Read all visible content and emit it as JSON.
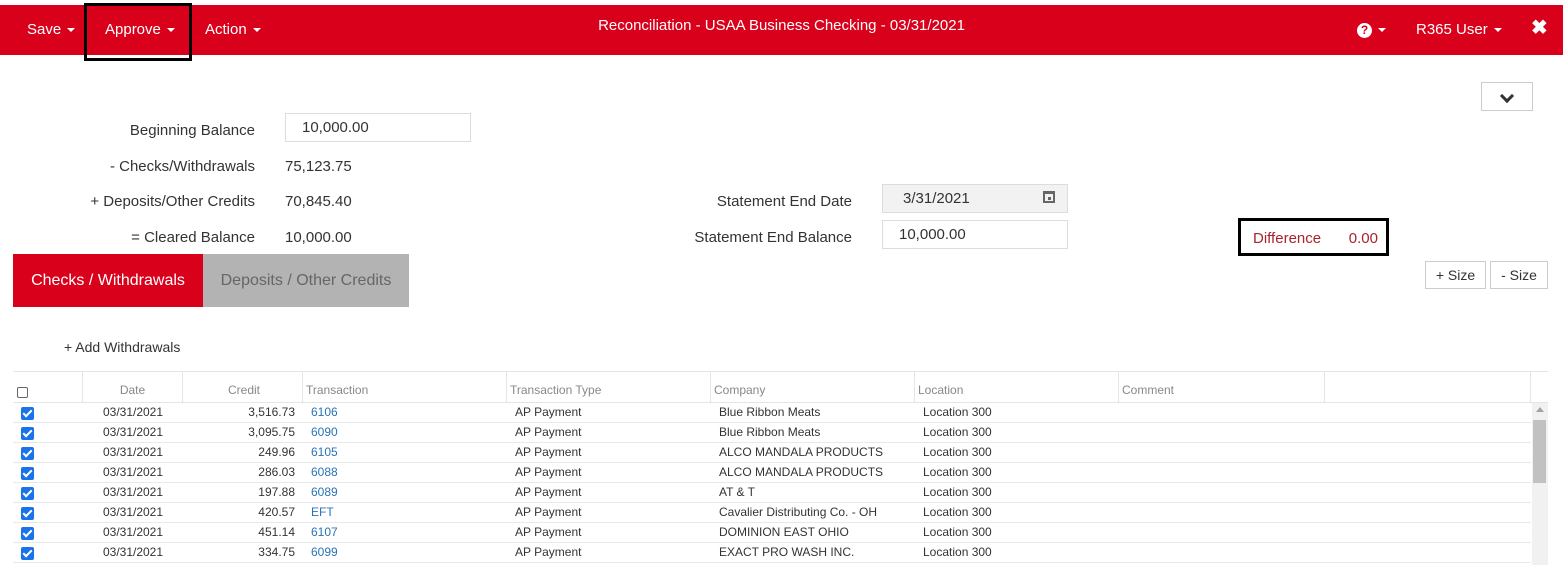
{
  "header": {
    "menus": [
      "Save",
      "Approve",
      "Action"
    ],
    "title": "Reconciliation - USAA Business Checking - 03/31/2021",
    "help_symbol": "?",
    "user_menu": "R365 User",
    "close_symbol": "✖"
  },
  "summary": {
    "beginning_balance_label": "Beginning Balance",
    "beginning_balance_value": "10,000.00",
    "checks_label": "- Checks/Withdrawals",
    "checks_value": "75,123.75",
    "deposits_label": "+ Deposits/Other Credits",
    "deposits_value": "70,845.40",
    "cleared_label": "= Cleared Balance",
    "cleared_value": "10,000.00",
    "statement_end_date_label": "Statement End Date",
    "statement_end_date_value": "3/31/2021",
    "statement_end_balance_label": "Statement End Balance",
    "statement_end_balance_value": "10,000.00",
    "difference_label": "Difference",
    "difference_value": "0.00"
  },
  "tabs": {
    "active": "Checks / Withdrawals",
    "inactive": "Deposits / Other Credits"
  },
  "size_buttons": {
    "increase": "+ Size",
    "decrease": "- Size"
  },
  "add_withdrawals": "+ Add Withdrawals",
  "grid": {
    "columns": [
      "Date",
      "Credit",
      "Transaction",
      "Transaction Type",
      "Company",
      "Location",
      "Comment"
    ],
    "rows": [
      {
        "checked": true,
        "date": "03/31/2021",
        "credit": "3,516.73",
        "transaction": "6106",
        "type": "AP Payment",
        "company": "Blue Ribbon Meats",
        "location": "Location 300",
        "comment": ""
      },
      {
        "checked": true,
        "date": "03/31/2021",
        "credit": "3,095.75",
        "transaction": "6090",
        "type": "AP Payment",
        "company": "Blue Ribbon Meats",
        "location": "Location 300",
        "comment": ""
      },
      {
        "checked": true,
        "date": "03/31/2021",
        "credit": "249.96",
        "transaction": "6105",
        "type": "AP Payment",
        "company": "ALCO MANDALA PRODUCTS",
        "location": "Location 300",
        "comment": ""
      },
      {
        "checked": true,
        "date": "03/31/2021",
        "credit": "286.03",
        "transaction": "6088",
        "type": "AP Payment",
        "company": "ALCO MANDALA PRODUCTS",
        "location": "Location 300",
        "comment": ""
      },
      {
        "checked": true,
        "date": "03/31/2021",
        "credit": "197.88",
        "transaction": "6089",
        "type": "AP Payment",
        "company": "AT & T",
        "location": "Location 300",
        "comment": ""
      },
      {
        "checked": true,
        "date": "03/31/2021",
        "credit": "420.57",
        "transaction": "EFT",
        "type": "AP Payment",
        "company": "Cavalier Distributing Co. - OH",
        "location": "Location 300",
        "comment": ""
      },
      {
        "checked": true,
        "date": "03/31/2021",
        "credit": "451.14",
        "transaction": "6107",
        "type": "AP Payment",
        "company": "DOMINION EAST OHIO",
        "location": "Location 300",
        "comment": ""
      },
      {
        "checked": true,
        "date": "03/31/2021",
        "credit": "334.75",
        "transaction": "6099",
        "type": "AP Payment",
        "company": "EXACT PRO WASH INC.",
        "location": "Location 300",
        "comment": ""
      }
    ]
  },
  "colors": {
    "brand_red": "#d9001b",
    "link_blue": "#2a73b6",
    "difference_red": "#a8232b",
    "checkbox_blue": "#1a73e8"
  }
}
